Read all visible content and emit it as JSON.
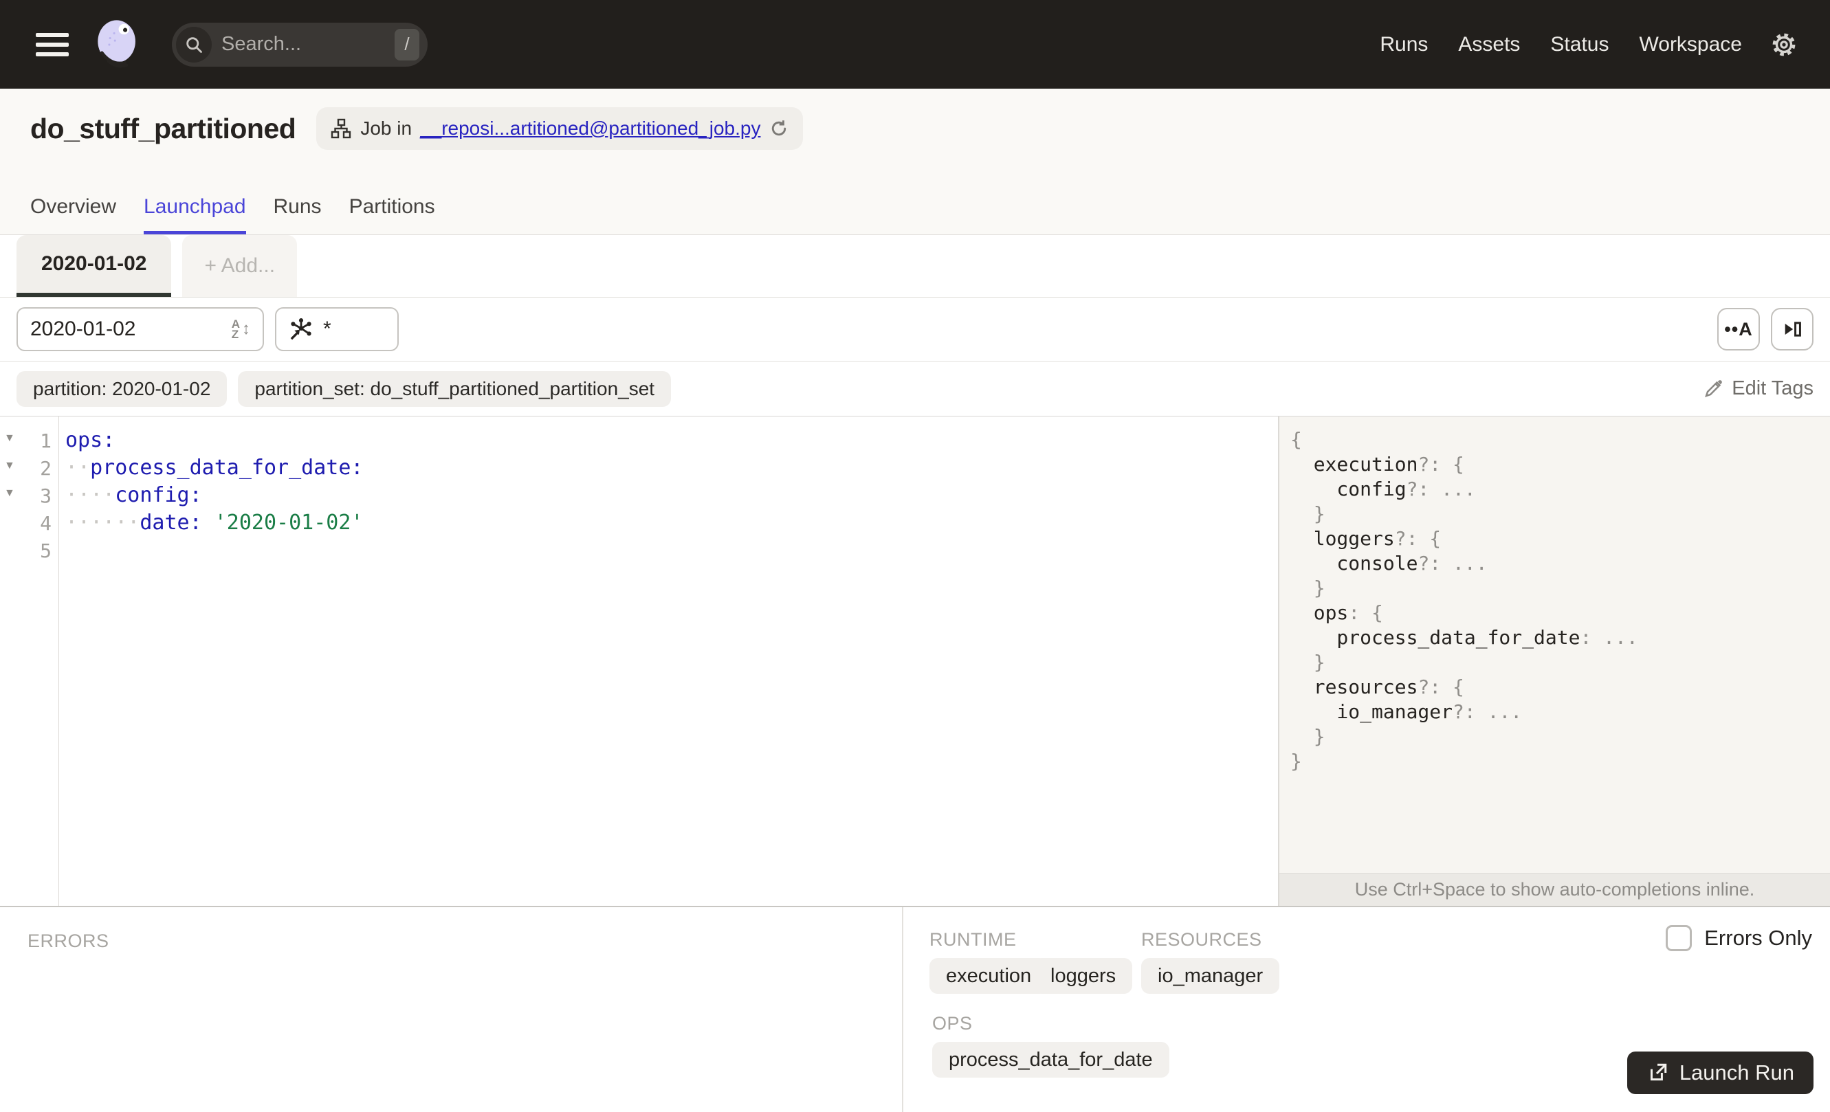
{
  "nav": {
    "search_placeholder": "Search...",
    "search_shortcut": "/",
    "links": [
      {
        "label": "Runs"
      },
      {
        "label": "Assets"
      },
      {
        "label": "Status"
      },
      {
        "label": "Workspace"
      }
    ]
  },
  "header": {
    "title": "do_stuff_partitioned",
    "badge": {
      "prefix": "Job in",
      "link": "__reposi...artitioned@partitioned_job.py"
    },
    "tabs": [
      {
        "label": "Overview"
      },
      {
        "label": "Launchpad"
      },
      {
        "label": "Runs"
      },
      {
        "label": "Partitions"
      }
    ]
  },
  "config_tabs": {
    "active": "2020-01-02",
    "add": "+ Add..."
  },
  "toolbar": {
    "partition_value": "2020-01-02",
    "selection_value": "*",
    "whitespace_button": "••A"
  },
  "tags": {
    "items": [
      {
        "text": "partition: 2020-01-02"
      },
      {
        "text": "partition_set: do_stuff_partitioned_partition_set"
      }
    ],
    "edit_label": "Edit Tags"
  },
  "editor": {
    "lines": [
      {
        "fold": "▼",
        "num": "1",
        "dots": "",
        "key": "ops",
        "colon": ":",
        "value": ""
      },
      {
        "fold": "▼",
        "num": "2",
        "dots": "··",
        "key": "process_data_for_date",
        "colon": ":",
        "value": ""
      },
      {
        "fold": "▼",
        "num": "3",
        "dots": "····",
        "key": "config",
        "colon": ":",
        "value": ""
      },
      {
        "fold": "",
        "num": "4",
        "dots": "······",
        "key": "date",
        "colon": ":",
        "value": " '2020-01-02'"
      },
      {
        "fold": "",
        "num": "5",
        "dots": "",
        "key": "",
        "colon": "",
        "value": ""
      }
    ]
  },
  "schema": {
    "lines": [
      {
        "key": "",
        "rest": "{"
      },
      {
        "key": "  execution",
        "rest": "?: {"
      },
      {
        "key": "    config",
        "rest": "?: ..."
      },
      {
        "key": "",
        "rest": "  }"
      },
      {
        "key": "  loggers",
        "rest": "?: {"
      },
      {
        "key": "    console",
        "rest": "?: ..."
      },
      {
        "key": "",
        "rest": "  }"
      },
      {
        "key": "  ops",
        "rest": ": {"
      },
      {
        "key": "    process_data_for_date",
        "rest": ": ..."
      },
      {
        "key": "",
        "rest": "  }"
      },
      {
        "key": "  resources",
        "rest": "?: {"
      },
      {
        "key": "    io_manager",
        "rest": "?: ..."
      },
      {
        "key": "",
        "rest": "  }"
      },
      {
        "key": "",
        "rest": "}"
      }
    ],
    "hint": "Use Ctrl+Space to show auto-completions inline."
  },
  "bottom": {
    "errors_label": "ERRORS",
    "errors_only_label": "Errors Only",
    "runtime": {
      "label": "RUNTIME",
      "tags": [
        "execution",
        "loggers"
      ]
    },
    "resources": {
      "label": "RESOURCES",
      "tags": [
        "io_manager"
      ]
    },
    "ops": {
      "label": "OPS",
      "tags": [
        "process_data_for_date"
      ]
    },
    "launch_label": "Launch Run"
  },
  "colors": {
    "navbar_bg": "#221f1c",
    "accent_tab": "#4a45d8",
    "link_blue": "#2823c0",
    "code_key": "#1e1caf",
    "code_string": "#1a7d46",
    "launch_button_bg": "#2b2825"
  }
}
